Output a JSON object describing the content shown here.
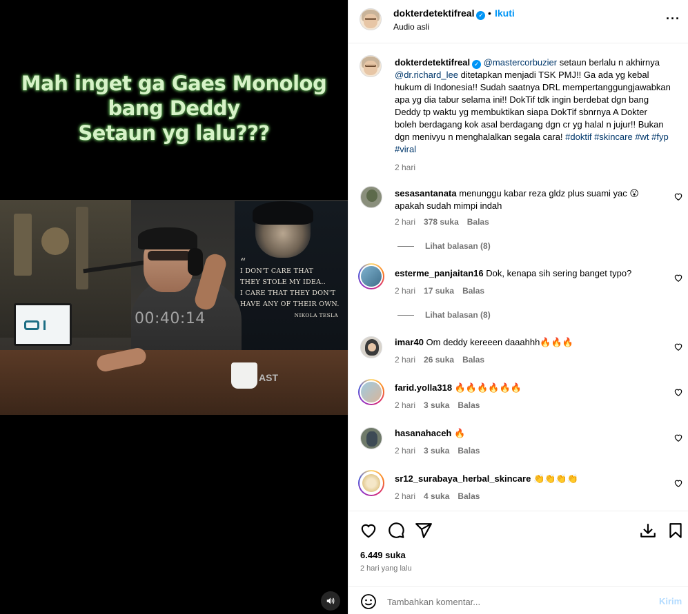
{
  "post": {
    "overlay_lines": [
      "Mah inget ga Gaes Monolog",
      "bang Deddy",
      "Setaun yg lalu???"
    ],
    "video_timecode": "00:40:14",
    "poster_quote": [
      "I DON'T CARE THAT",
      "THEY STOLE MY IDEA..",
      "I CARE THAT THEY DON'T",
      "HAVE ANY OF THEIR OWN."
    ],
    "poster_author": "NIKOLA TESLA",
    "studio_sign": "AST"
  },
  "header": {
    "username": "dokterdetektifreal",
    "separator": "•",
    "follow_label": "Ikuti",
    "audio_label": "Audio asli",
    "more_icon": "more-horizontal-icon"
  },
  "caption": {
    "username": "dokterdetektifreal",
    "mention1": "@mastercorbuzier",
    "text1": " setaun berlalu n akhirnya ",
    "mention2": "@dr.richard_lee",
    "text2": " ditetapkan menjadi TSK PMJ!! Ga ada yg kebal hukum di Indonesia!! Sudah saatnya DRL mempertanggungjawabkan apa yg dia tabur selama ini!! DokTif tdk ingin berdebat dgn bang Deddy tp waktu yg membuktikan siapa DokTif sbnrnya A Dokter boleh berdagang kok asal berdagang dgn cr yg halal n jujur!! Bukan dgn menivyu n menghalalkan segala cara! ",
    "hashtags": "#doktif #skincare #wt #fyp #viral",
    "time": "2 hari"
  },
  "comments": [
    {
      "username": "sesasantanata",
      "text": "menunggu kabar reza gldz plus suami yac 😮 apakah sudah mimpi indah",
      "time": "2 hari",
      "likes": "378 suka",
      "reply": "Balas",
      "view_replies": "Lihat balasan (8)"
    },
    {
      "username": "esterme_panjaitan16",
      "text": "Dok, kenapa sih sering banget typo?",
      "time": "2 hari",
      "likes": "17 suka",
      "reply": "Balas",
      "view_replies": "Lihat balasan (8)"
    },
    {
      "username": "imar40",
      "text": "Om deddy kereeen daaahhh🔥🔥🔥",
      "time": "2 hari",
      "likes": "26 suka",
      "reply": "Balas"
    },
    {
      "username": "farid.yolla318",
      "text": "🔥🔥🔥🔥🔥🔥",
      "time": "2 hari",
      "likes": "3 suka",
      "reply": "Balas"
    },
    {
      "username": "hasanahaceh",
      "text": "🔥",
      "time": "2 hari",
      "likes": "3 suka",
      "reply": "Balas"
    },
    {
      "username": "sr12_surabaya_herbal_skincare",
      "text": "👏👏👏👏",
      "time": "2 hari",
      "likes": "4 suka",
      "reply": "Balas"
    }
  ],
  "actions": {
    "likes": "6.449 suka",
    "posted_ago": "2 hari yang lalu",
    "icons": [
      "heart-icon",
      "comment-icon",
      "share-icon",
      "download-icon",
      "bookmark-icon"
    ]
  },
  "composer": {
    "placeholder": "Tambahkan komentar...",
    "send_label": "Kirim"
  },
  "colors": {
    "link": "#0095f6",
    "mention": "#00376b",
    "muted": "#737373",
    "overlay_text": "#d7f3c8"
  }
}
